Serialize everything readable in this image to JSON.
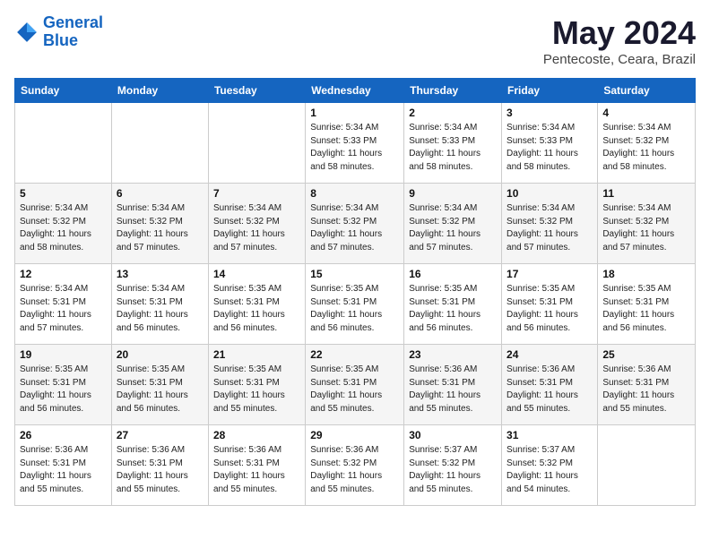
{
  "logo": {
    "line1": "General",
    "line2": "Blue"
  },
  "title": "May 2024",
  "subtitle": "Pentecoste, Ceara, Brazil",
  "days_of_week": [
    "Sunday",
    "Monday",
    "Tuesday",
    "Wednesday",
    "Thursday",
    "Friday",
    "Saturday"
  ],
  "weeks": [
    [
      {
        "num": "",
        "info": ""
      },
      {
        "num": "",
        "info": ""
      },
      {
        "num": "",
        "info": ""
      },
      {
        "num": "1",
        "info": "Sunrise: 5:34 AM\nSunset: 5:33 PM\nDaylight: 11 hours\nand 58 minutes."
      },
      {
        "num": "2",
        "info": "Sunrise: 5:34 AM\nSunset: 5:33 PM\nDaylight: 11 hours\nand 58 minutes."
      },
      {
        "num": "3",
        "info": "Sunrise: 5:34 AM\nSunset: 5:33 PM\nDaylight: 11 hours\nand 58 minutes."
      },
      {
        "num": "4",
        "info": "Sunrise: 5:34 AM\nSunset: 5:32 PM\nDaylight: 11 hours\nand 58 minutes."
      }
    ],
    [
      {
        "num": "5",
        "info": "Sunrise: 5:34 AM\nSunset: 5:32 PM\nDaylight: 11 hours\nand 58 minutes."
      },
      {
        "num": "6",
        "info": "Sunrise: 5:34 AM\nSunset: 5:32 PM\nDaylight: 11 hours\nand 57 minutes."
      },
      {
        "num": "7",
        "info": "Sunrise: 5:34 AM\nSunset: 5:32 PM\nDaylight: 11 hours\nand 57 minutes."
      },
      {
        "num": "8",
        "info": "Sunrise: 5:34 AM\nSunset: 5:32 PM\nDaylight: 11 hours\nand 57 minutes."
      },
      {
        "num": "9",
        "info": "Sunrise: 5:34 AM\nSunset: 5:32 PM\nDaylight: 11 hours\nand 57 minutes."
      },
      {
        "num": "10",
        "info": "Sunrise: 5:34 AM\nSunset: 5:32 PM\nDaylight: 11 hours\nand 57 minutes."
      },
      {
        "num": "11",
        "info": "Sunrise: 5:34 AM\nSunset: 5:32 PM\nDaylight: 11 hours\nand 57 minutes."
      }
    ],
    [
      {
        "num": "12",
        "info": "Sunrise: 5:34 AM\nSunset: 5:31 PM\nDaylight: 11 hours\nand 57 minutes."
      },
      {
        "num": "13",
        "info": "Sunrise: 5:34 AM\nSunset: 5:31 PM\nDaylight: 11 hours\nand 56 minutes."
      },
      {
        "num": "14",
        "info": "Sunrise: 5:35 AM\nSunset: 5:31 PM\nDaylight: 11 hours\nand 56 minutes."
      },
      {
        "num": "15",
        "info": "Sunrise: 5:35 AM\nSunset: 5:31 PM\nDaylight: 11 hours\nand 56 minutes."
      },
      {
        "num": "16",
        "info": "Sunrise: 5:35 AM\nSunset: 5:31 PM\nDaylight: 11 hours\nand 56 minutes."
      },
      {
        "num": "17",
        "info": "Sunrise: 5:35 AM\nSunset: 5:31 PM\nDaylight: 11 hours\nand 56 minutes."
      },
      {
        "num": "18",
        "info": "Sunrise: 5:35 AM\nSunset: 5:31 PM\nDaylight: 11 hours\nand 56 minutes."
      }
    ],
    [
      {
        "num": "19",
        "info": "Sunrise: 5:35 AM\nSunset: 5:31 PM\nDaylight: 11 hours\nand 56 minutes."
      },
      {
        "num": "20",
        "info": "Sunrise: 5:35 AM\nSunset: 5:31 PM\nDaylight: 11 hours\nand 56 minutes."
      },
      {
        "num": "21",
        "info": "Sunrise: 5:35 AM\nSunset: 5:31 PM\nDaylight: 11 hours\nand 55 minutes."
      },
      {
        "num": "22",
        "info": "Sunrise: 5:35 AM\nSunset: 5:31 PM\nDaylight: 11 hours\nand 55 minutes."
      },
      {
        "num": "23",
        "info": "Sunrise: 5:36 AM\nSunset: 5:31 PM\nDaylight: 11 hours\nand 55 minutes."
      },
      {
        "num": "24",
        "info": "Sunrise: 5:36 AM\nSunset: 5:31 PM\nDaylight: 11 hours\nand 55 minutes."
      },
      {
        "num": "25",
        "info": "Sunrise: 5:36 AM\nSunset: 5:31 PM\nDaylight: 11 hours\nand 55 minutes."
      }
    ],
    [
      {
        "num": "26",
        "info": "Sunrise: 5:36 AM\nSunset: 5:31 PM\nDaylight: 11 hours\nand 55 minutes."
      },
      {
        "num": "27",
        "info": "Sunrise: 5:36 AM\nSunset: 5:31 PM\nDaylight: 11 hours\nand 55 minutes."
      },
      {
        "num": "28",
        "info": "Sunrise: 5:36 AM\nSunset: 5:31 PM\nDaylight: 11 hours\nand 55 minutes."
      },
      {
        "num": "29",
        "info": "Sunrise: 5:36 AM\nSunset: 5:32 PM\nDaylight: 11 hours\nand 55 minutes."
      },
      {
        "num": "30",
        "info": "Sunrise: 5:37 AM\nSunset: 5:32 PM\nDaylight: 11 hours\nand 55 minutes."
      },
      {
        "num": "31",
        "info": "Sunrise: 5:37 AM\nSunset: 5:32 PM\nDaylight: 11 hours\nand 54 minutes."
      },
      {
        "num": "",
        "info": ""
      }
    ]
  ]
}
